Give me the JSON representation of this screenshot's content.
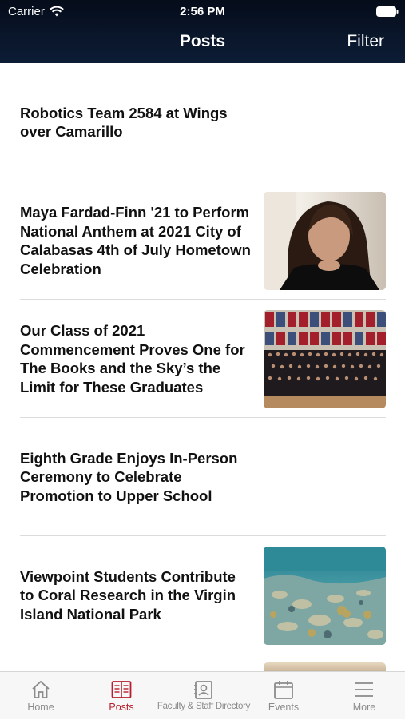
{
  "status_bar": {
    "carrier": "Carrier",
    "time": "2:56 PM"
  },
  "header": {
    "title": "Posts",
    "filter_label": "Filter"
  },
  "posts": [
    {
      "title": "Robotics Team 2584 at Wings over Camarillo",
      "image": "none"
    },
    {
      "title": "Maya Fardad-Finn '21 to Perform National Anthem at 2021 City of Calabasas 4th of July Hometown Celebration",
      "image": "student-portrait-photo"
    },
    {
      "title": "Our Class of 2021 Commencement Proves One for The Books and the Sky’s the Limit for These Graduates",
      "image": "graduates-group-photo"
    },
    {
      "title": "Eighth Grade Enjoys In-Person Ceremony to Celebrate Promotion to Upper School",
      "image": "none"
    },
    {
      "title": "Viewpoint Students Contribute to Coral Research in the Virgin Island National Park",
      "image": "coral-reef-photo"
    }
  ],
  "tabs": [
    {
      "label": "Home",
      "icon": "home-icon",
      "active": false
    },
    {
      "label": "Posts",
      "icon": "newspaper-icon",
      "active": true
    },
    {
      "label": "Faculty & Staff Directory",
      "icon": "contact-card-icon",
      "active": false
    },
    {
      "label": "Events",
      "icon": "calendar-icon",
      "active": false
    },
    {
      "label": "More",
      "icon": "menu-icon",
      "active": false
    }
  ],
  "colors": {
    "header_bg": "#0d1d36",
    "active_tab": "#b81f2e",
    "inactive_tab": "#8b8b8b"
  }
}
